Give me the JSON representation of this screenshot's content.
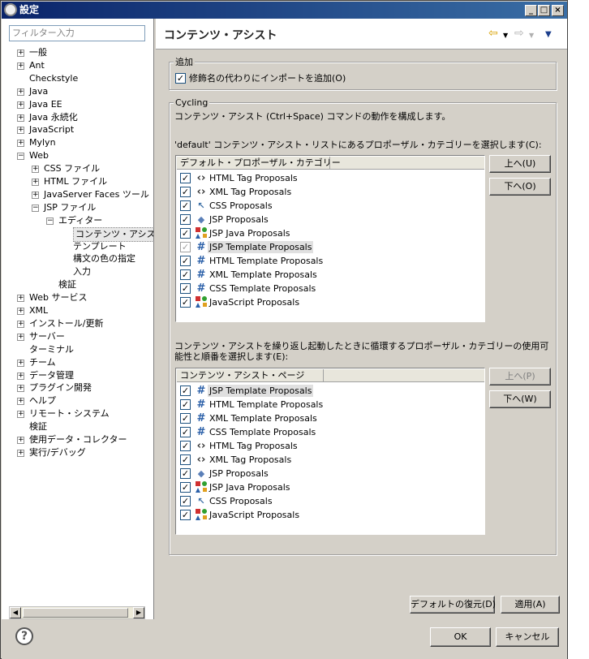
{
  "window": {
    "title": "設定"
  },
  "filter": {
    "placeholder": "フィルター入力"
  },
  "tree": [
    {
      "label": "一般",
      "depth": 0,
      "expander": "+"
    },
    {
      "label": "Ant",
      "depth": 0,
      "expander": "+"
    },
    {
      "label": "Checkstyle",
      "depth": 0,
      "expander": ""
    },
    {
      "label": "Java",
      "depth": 0,
      "expander": "+"
    },
    {
      "label": "Java EE",
      "depth": 0,
      "expander": "+"
    },
    {
      "label": "Java 永続化",
      "depth": 0,
      "expander": "+"
    },
    {
      "label": "JavaScript",
      "depth": 0,
      "expander": "+"
    },
    {
      "label": "Mylyn",
      "depth": 0,
      "expander": "+"
    },
    {
      "label": "Web",
      "depth": 0,
      "expander": "−"
    },
    {
      "label": "CSS ファイル",
      "depth": 1,
      "expander": "+"
    },
    {
      "label": "HTML ファイル",
      "depth": 1,
      "expander": "+"
    },
    {
      "label": "JavaServer Faces ツール",
      "depth": 1,
      "expander": "+"
    },
    {
      "label": "JSP ファイル",
      "depth": 1,
      "expander": "−"
    },
    {
      "label": "エディター",
      "depth": 2,
      "expander": "−"
    },
    {
      "label": "コンテンツ・アシスト",
      "depth": 3,
      "expander": "",
      "selected": true
    },
    {
      "label": "テンプレート",
      "depth": 3,
      "expander": ""
    },
    {
      "label": "構文の色の指定",
      "depth": 3,
      "expander": ""
    },
    {
      "label": "入力",
      "depth": 3,
      "expander": ""
    },
    {
      "label": "検証",
      "depth": 2,
      "expander": ""
    },
    {
      "label": "Web サービス",
      "depth": 0,
      "expander": "+"
    },
    {
      "label": "XML",
      "depth": 0,
      "expander": "+"
    },
    {
      "label": "インストール/更新",
      "depth": 0,
      "expander": "+"
    },
    {
      "label": "サーバー",
      "depth": 0,
      "expander": "+"
    },
    {
      "label": "ターミナル",
      "depth": 0,
      "expander": ""
    },
    {
      "label": "チーム",
      "depth": 0,
      "expander": "+"
    },
    {
      "label": "データ管理",
      "depth": 0,
      "expander": "+"
    },
    {
      "label": "プラグイン開発",
      "depth": 0,
      "expander": "+"
    },
    {
      "label": "ヘルプ",
      "depth": 0,
      "expander": "+"
    },
    {
      "label": "リモート・システム",
      "depth": 0,
      "expander": "+"
    },
    {
      "label": "検証",
      "depth": 0,
      "expander": ""
    },
    {
      "label": "使用データ・コレクター",
      "depth": 0,
      "expander": "+"
    },
    {
      "label": "実行/デバッグ",
      "depth": 0,
      "expander": "+"
    }
  ],
  "page": {
    "title": "コンテンツ・アシスト",
    "add_group": {
      "label": "追加",
      "checkbox_label": "修飾名の代わりにインポートを追加(O)",
      "checked": true
    },
    "cycling_group": {
      "label": "Cycling",
      "description": "コンテンツ・アシスト (Ctrl+Space) コマンドの動作を構成します。",
      "default_label": "'default' コンテンツ・アシスト・リストにあるプロポーザル・カテゴリーを選択します(C):",
      "default_header": "デフォルト・プロポーザル・カテゴリー",
      "default_items": [
        {
          "label": "HTML Tag Proposals",
          "icon": "angle-brackets-icon",
          "checked": true
        },
        {
          "label": "XML Tag Proposals",
          "icon": "angle-brackets-icon",
          "checked": true
        },
        {
          "label": "CSS Proposals",
          "icon": "css-icon",
          "checked": true
        },
        {
          "label": "JSP Proposals",
          "icon": "diamond-icon",
          "checked": true
        },
        {
          "label": "JSP Java Proposals",
          "icon": "shapes-icon",
          "checked": true
        },
        {
          "label": "JSP Template Proposals",
          "icon": "hash-icon",
          "checked": true,
          "selected": true,
          "disabled": true
        },
        {
          "label": "HTML Template Proposals",
          "icon": "hash-icon",
          "checked": true
        },
        {
          "label": "XML Template Proposals",
          "icon": "hash-icon",
          "checked": true
        },
        {
          "label": "CSS Template Proposals",
          "icon": "hash-icon",
          "checked": true
        },
        {
          "label": "JavaScript Proposals",
          "icon": "shapes-icon",
          "checked": true
        }
      ],
      "up_button": "上へ(U)",
      "down_button": "下へ(O)",
      "cycle_label": "コンテンツ・アシストを繰り返し起動したときに循環するプロポーザル・カテゴリーの使用可能性と順番を選択します(E):",
      "cycle_header": "コンテンツ・アシスト・ページ",
      "cycle_items": [
        {
          "label": "JSP Template Proposals",
          "icon": "hash-icon",
          "checked": true,
          "selected": true
        },
        {
          "label": "HTML Template Proposals",
          "icon": "hash-icon",
          "checked": true
        },
        {
          "label": "XML Template Proposals",
          "icon": "hash-icon",
          "checked": true
        },
        {
          "label": "CSS Template Proposals",
          "icon": "hash-icon",
          "checked": true
        },
        {
          "label": "HTML Tag Proposals",
          "icon": "angle-brackets-icon",
          "checked": true
        },
        {
          "label": "XML Tag Proposals",
          "icon": "angle-brackets-icon",
          "checked": true
        },
        {
          "label": "JSP Proposals",
          "icon": "diamond-icon",
          "checked": true
        },
        {
          "label": "JSP Java Proposals",
          "icon": "shapes-icon",
          "checked": true
        },
        {
          "label": "CSS Proposals",
          "icon": "css-icon",
          "checked": true
        },
        {
          "label": "JavaScript Proposals",
          "icon": "shapes-icon",
          "checked": true
        }
      ],
      "up2_button": "上へ(P)",
      "down2_button": "下へ(W)"
    },
    "restore_button": "デフォルトの復元(D)",
    "apply_button": "適用(A)"
  },
  "bottom": {
    "ok": "OK",
    "cancel": "キャンセル"
  }
}
